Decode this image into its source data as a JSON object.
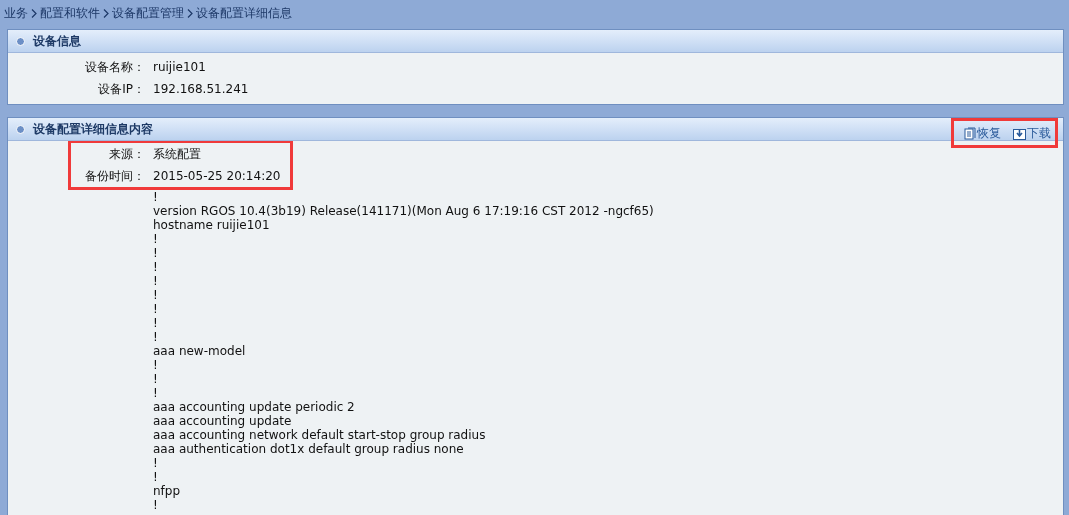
{
  "breadcrumb": [
    "业务",
    "配置和软件",
    "设备配置管理",
    "设备配置详细信息"
  ],
  "device_info": {
    "title": "设备信息",
    "fields": [
      {
        "label": "设备名称：",
        "value": "ruijie101"
      },
      {
        "label": "设备IP：",
        "value": "192.168.51.241"
      }
    ]
  },
  "config_detail": {
    "title": "设备配置详细信息内容",
    "actions": {
      "highlighted": true,
      "items": [
        {
          "kind": "restore",
          "label": "恢复"
        },
        {
          "kind": "download",
          "label": "下载"
        }
      ]
    },
    "meta": {
      "highlighted": true,
      "fields": [
        {
          "label": "来源：",
          "value": "系统配置"
        },
        {
          "label": "备份时间：",
          "value": "2015-05-25 20:14:20"
        }
      ]
    },
    "config_lines": [
      "!",
      "version RGOS 10.4(3b19) Release(141171)(Mon Aug 6 17:19:16 CST 2012 -ngcf65)",
      "hostname ruijie101",
      "!",
      "!",
      "!",
      "!",
      "!",
      "!",
      "!",
      "!",
      "aaa new-model",
      "!",
      "!",
      "!",
      "aaa accounting update periodic 2",
      "aaa accounting update",
      "aaa accounting network default start-stop group radius",
      "aaa authentication dot1x default group radius none",
      "!",
      "!",
      "nfpp",
      "!"
    ]
  }
}
